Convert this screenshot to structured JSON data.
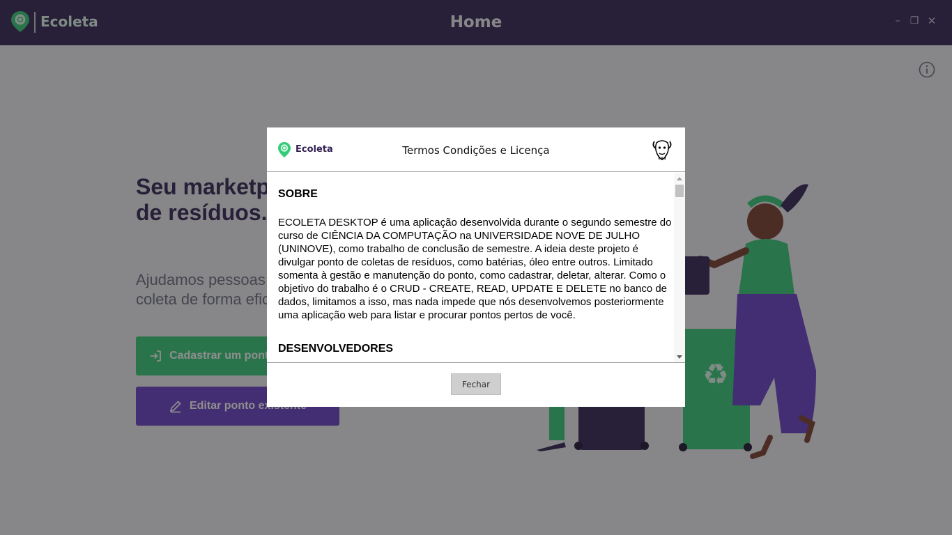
{
  "window": {
    "brand": "Ecoleta",
    "title": "Home",
    "controls": {
      "minimize": "–",
      "maximize": "❐",
      "close": "✕"
    }
  },
  "home": {
    "hero_title": "Seu marketplace de coleta de resíduos.",
    "hero_subtitle": "Ajudamos pessoas a encontrarem pontos de coleta de forma eficiente.",
    "register_button": "Cadastrar um ponto de coleta",
    "edit_button": "Editar ponto existente"
  },
  "modal": {
    "brand": "Ecoleta",
    "title": "Termos Condições e Licença",
    "sections": [
      {
        "heading": "SOBRE",
        "text": "ECOLETA DESKTOP é uma aplicação desenvolvida durante o segundo semestre do curso de CIÊNCIA DA COMPUTAÇÃO na UNIVERSIDADE NOVE DE JULHO (UNINOVE), como trabalho de conclusão de semestre. A ideia deste projeto é divulgar ponto de coletas de resíduos, como batérias, óleo entre outros. Limitado somenta à gestão e manutenção do ponto, como cadastrar, deletar, alterar. Como o objetivo do trabalho é o CRUD - CREATE, READ, UPDATE E DELETE no banco de dados, limitamos a isso, mas nada impede que nós desenvolvemos posteriormente uma aplicação web para listar e procurar pontos pertos de você."
      },
      {
        "heading": "DESENVOLVEDORES"
      }
    ],
    "close_button": "Fechar"
  },
  "colors": {
    "primary": "#34cb79",
    "title": "#322153",
    "accent": "#6a3ec9",
    "overlay": "rgba(30,30,30,0.5)"
  },
  "icons": [
    "ecoleta-logo-icon",
    "info-icon",
    "login-icon",
    "edit-icon",
    "gnu-head-icon",
    "scroll-up-icon",
    "scroll-down-icon"
  ]
}
